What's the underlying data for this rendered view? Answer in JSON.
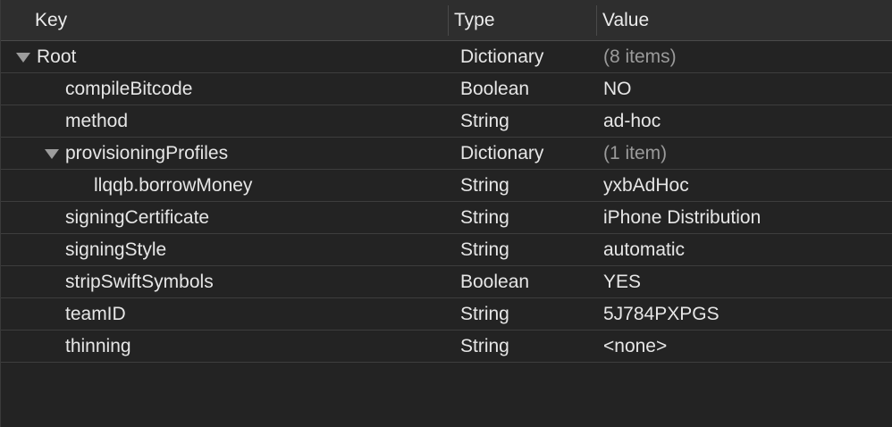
{
  "columns": {
    "key": "Key",
    "type": "Type",
    "value": "Value"
  },
  "rows": [
    {
      "key": "Root",
      "type": "Dictionary",
      "value": "(8 items)",
      "muted": true,
      "expanded": true,
      "level": 0
    },
    {
      "key": "compileBitcode",
      "type": "Boolean",
      "value": "NO",
      "muted": false,
      "level": 1
    },
    {
      "key": "method",
      "type": "String",
      "value": "ad-hoc",
      "muted": false,
      "level": 1
    },
    {
      "key": "provisioningProfiles",
      "type": "Dictionary",
      "value": "(1 item)",
      "muted": true,
      "expanded": true,
      "level": 1
    },
    {
      "key": "llqqb.borrowMoney",
      "type": "String",
      "value": "yxbAdHoc",
      "muted": false,
      "level": 2
    },
    {
      "key": "signingCertificate",
      "type": "String",
      "value": "iPhone Distribution",
      "muted": false,
      "level": 1
    },
    {
      "key": "signingStyle",
      "type": "String",
      "value": "automatic",
      "muted": false,
      "level": 1
    },
    {
      "key": "stripSwiftSymbols",
      "type": "Boolean",
      "value": "YES",
      "muted": false,
      "level": 1
    },
    {
      "key": "teamID",
      "type": "String",
      "value": "5J784PXPGS",
      "muted": false,
      "level": 1
    },
    {
      "key": "thinning",
      "type": "String",
      "value": "<none>",
      "muted": false,
      "level": 1
    }
  ],
  "icons": {
    "disclosure": "disclosure-triangle-expanded-icon"
  }
}
